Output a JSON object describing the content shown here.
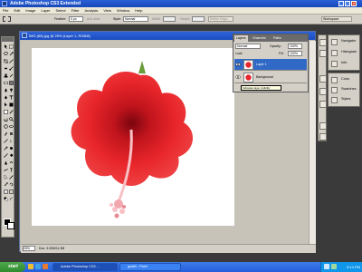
{
  "app": {
    "title": "Adobe Photoshop CS3 Extended",
    "window_buttons": [
      "_",
      "□",
      "×"
    ]
  },
  "menu": {
    "items": [
      "File",
      "Edit",
      "Image",
      "Layer",
      "Select",
      "Filter",
      "Analysis",
      "View",
      "Window",
      "Help"
    ],
    "workspace_label": "Workspace"
  },
  "options": {
    "feather_label": "Feather:",
    "feather_value": "0 px",
    "antialias_label": "Anti-alias",
    "style_label": "Style:",
    "style_value": "Normal",
    "width_label": "Width:",
    "height_label": "Height:",
    "refine_edge_label": "Refine Edge..."
  },
  "document": {
    "title": "IMG (68).jpg @ 25% (Layer 1, RGB/8)",
    "zoom": "25%",
    "doc_info": "Doc: 3.00M/11.9M"
  },
  "layers_panel": {
    "tabs": [
      "Layers",
      "Channels",
      "Paths"
    ],
    "blend_mode": "Normal",
    "opacity_label": "Opacity:",
    "opacity_value": "100%",
    "lock_label": "Lock:",
    "fill_label": "Fill:",
    "fill_value": "100%",
    "layers": [
      {
        "name": "Layer 1",
        "selected": true
      },
      {
        "name": "Background",
        "selected": false
      }
    ],
    "tooltip": "Indicates layer visibility"
  },
  "right_panels": {
    "group1": [
      "Navigator",
      "Histogram",
      "Info"
    ],
    "group2": [
      "Color",
      "Swatches",
      "Styles"
    ]
  },
  "taskbar": {
    "start_label": "start",
    "buttons": [
      {
        "label": "Adobe Photoshop CS3 ...",
        "active": true
      },
      {
        "label": "graf#t - Paint",
        "active": false
      }
    ],
    "clock": "5:14 PM"
  },
  "colors": {
    "title_bar": "#1848b8",
    "selected_layer": "#3169c6",
    "flower": "#e8262b"
  }
}
